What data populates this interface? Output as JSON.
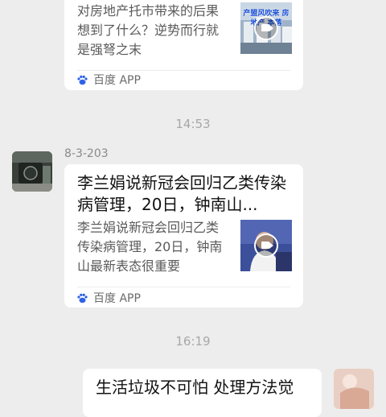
{
  "messages": [
    {
      "card": {
        "description": "对房地产托市带来的后果想到了什么？逆势而行就是强弩之末",
        "thumb_caption": "产盟风吹来 房地产 本落",
        "source": "百度 APP"
      }
    },
    {
      "timestamp": "14:53"
    },
    {
      "sender": "8-3-203",
      "card": {
        "title": "李兰娟说新冠会回归乙类传染病管理，20日，钟南山...",
        "description": "李兰娟说新冠会回归乙类传染病管理，20日，钟南山最新表态很重要",
        "source": "百度 APP"
      }
    },
    {
      "timestamp": "16:19"
    },
    {
      "card": {
        "title": "生活垃圾不可怕 处理方法觉"
      }
    }
  ],
  "colors": {
    "background": "#ededed",
    "card": "#ffffff",
    "baidu_blue": "#2f62e6"
  },
  "icons": [
    "baidu-paw-icon",
    "play-icon"
  ]
}
